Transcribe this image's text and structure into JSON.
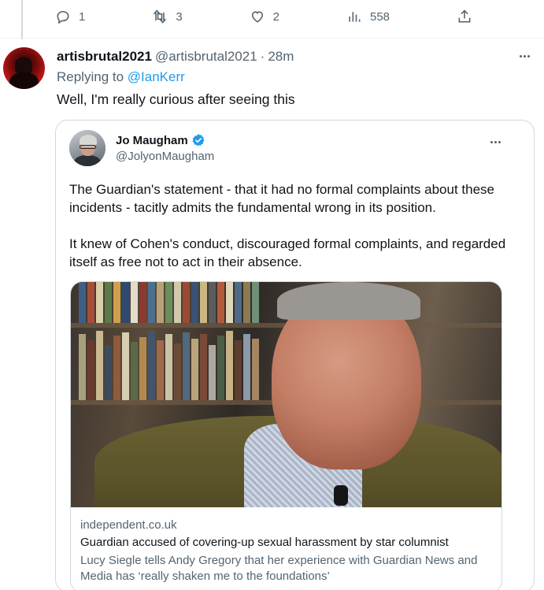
{
  "previous_tweet": {
    "actions": [
      {
        "name": "reply",
        "count": "1"
      },
      {
        "name": "retweet",
        "count": "3"
      },
      {
        "name": "like",
        "count": "2"
      },
      {
        "name": "views",
        "count": "558"
      },
      {
        "name": "share",
        "count": ""
      }
    ]
  },
  "reply_tweet": {
    "display_name": "artisbrutal2021",
    "handle": "@artisbrutal2021",
    "separator": "·",
    "time": "28m",
    "replying_prefix": "Replying to ",
    "replying_to": "@IanKerr",
    "text": "Well, I'm really curious after seeing this",
    "avatar_icon": "avatar-silhouette-red"
  },
  "quoted_tweet": {
    "display_name": "Jo Maugham",
    "handle": "@JolyonMaugham",
    "verified": true,
    "paragraphs": [
      "The Guardian's statement - that it had no formal complaints about these incidents - tacitly admits the fundamental wrong in its position.",
      "It knew of Cohen's conduct, discouraged formal complaints, and regarded itself as free not to act in their absence."
    ],
    "link_card": {
      "domain": "independent.co.uk",
      "headline": "Guardian accused of covering-up sexual harassment by star columnist",
      "description": "Lucy Siegle tells Andy Gregory that her experience with Guardian News and Media has ‘really shaken me to the foundations’"
    }
  },
  "colors": {
    "text_primary": "#0f1419",
    "text_secondary": "#536471",
    "link": "#1d9bf0",
    "border": "#cfd9de"
  }
}
